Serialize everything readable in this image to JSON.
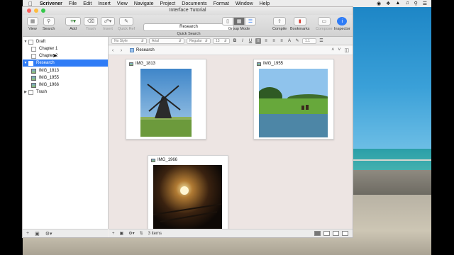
{
  "menubar": {
    "app": "Scrivener",
    "items": [
      "File",
      "Edit",
      "Insert",
      "View",
      "Navigate",
      "Project",
      "Documents",
      "Format",
      "Window",
      "Help"
    ]
  },
  "window": {
    "title": "Interface Tutorial"
  },
  "toolbar": {
    "view": "View",
    "search": "Search",
    "add": "Add",
    "trash": "Trash",
    "insert": "Insert",
    "quick_ref": "Quick Ref",
    "quick_search_value": "Research",
    "quick_search_label": "Quick Search",
    "group_mode": "Group Mode",
    "compile": "Compile",
    "bookmarks": "Bookmarks",
    "compose": "Compose",
    "inspector": "Inspector"
  },
  "binder": {
    "items": [
      {
        "label": "Draft"
      },
      {
        "label": "Chapter 1"
      },
      {
        "label": "Chapter 2"
      },
      {
        "label": "Research"
      },
      {
        "label": "IMG_1813"
      },
      {
        "label": "IMG_1955"
      },
      {
        "label": "IMG_1966"
      },
      {
        "label": "Trash"
      }
    ]
  },
  "formatbar": {
    "style": "No Style",
    "font": "Arial",
    "weight": "Regular",
    "size": "13",
    "spacing": "1.1"
  },
  "header": {
    "title": "Research"
  },
  "cards": [
    {
      "title": "IMG_1813"
    },
    {
      "title": "IMG_1955"
    },
    {
      "title": "IMG_1966"
    }
  ],
  "status": {
    "items_count": "3 items"
  },
  "icons": {
    "apple": "apple-icon",
    "wifi": "wifi-icon",
    "search": "spotlight-icon"
  }
}
